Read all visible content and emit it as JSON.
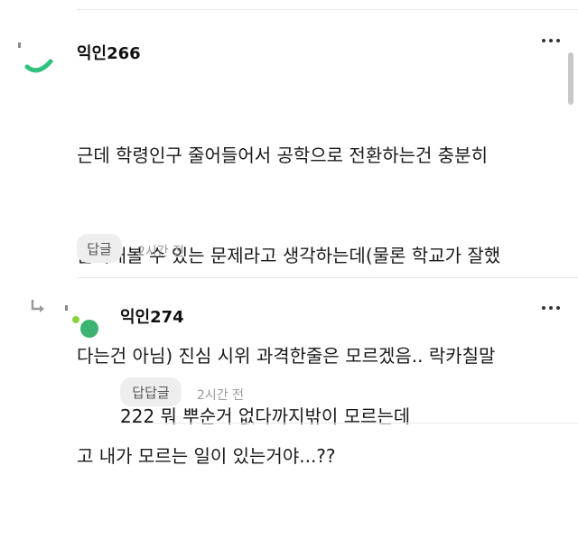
{
  "comments": [
    {
      "author": "익인266",
      "lines": [
        "근데 학령인구 줄어들어서 공학으로 전환하는건 충분히",
        "논의해볼 수 있는 문제라고 생각하는데(물론 학교가 잘했",
        "다는건 아님) 진심 시위 과격한줄은 모르겠음.. 락카칠말",
        "고 내가 모르는 일이 있는거야...??"
      ],
      "reply_label": "답글",
      "time": "2시간 전",
      "avatar_color": "#2ec27e"
    },
    {
      "author": "익인274",
      "lines": [
        "222 뭐 뿌순거 없다까지밖이 모르는데"
      ],
      "reply_label": "답답글",
      "time": "2시간 전",
      "avatar_color": "#3cb371",
      "avatar_dot_color": "#8bd33a"
    }
  ],
  "icons": {
    "more": "more-vertical-icon",
    "reply_arrow": "reply-arrow-icon"
  }
}
